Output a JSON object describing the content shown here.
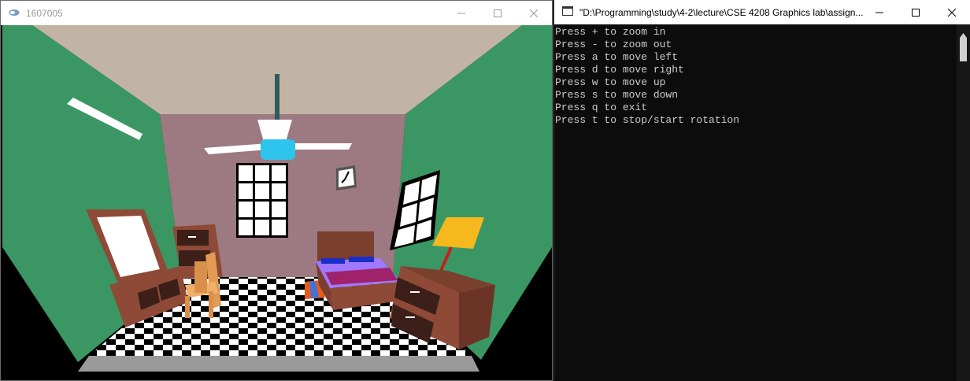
{
  "gl_window": {
    "title": "1607005",
    "colors": {
      "ceiling": "#c2b4a4",
      "back_wall": "#9d7982",
      "side_walls": "#3a9764",
      "floor_base": "#9a9a9a",
      "bed_sheet": "#9f79ff",
      "blanket": "#a0226a",
      "wood": "#8e4a36",
      "lamp_shade": "#f5b91e",
      "fan_motor": "#2ec4ee"
    },
    "icons": [
      "app-icon",
      "minimize-icon",
      "maximize-icon",
      "close-icon"
    ]
  },
  "console_window": {
    "title": "\"D:\\Programming\\study\\4-2\\lecture\\CSE 4208 Graphics lab\\assign...",
    "lines": [
      "Press + to zoom in",
      "Press - to zoom out",
      "Press a to move left",
      "Press d to move right",
      "Press w to move up",
      "Press s to move down",
      "Press q to exit",
      "Press t to stop/start rotation"
    ],
    "text_color": "#cccccc"
  }
}
